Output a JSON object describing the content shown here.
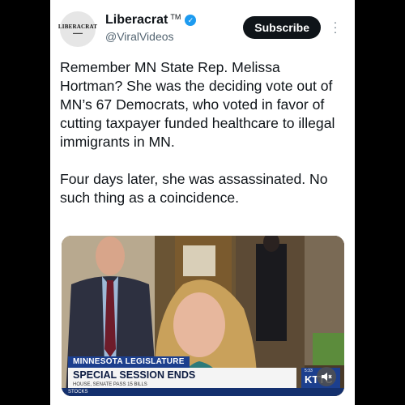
{
  "account": {
    "avatar_logo_text": "LIBERACRAT",
    "display_name": "Liberacrat",
    "trademark": "TM",
    "handle": "@ViralVideos",
    "verified_color": "#1d9bf0"
  },
  "actions": {
    "subscribe_label": "Subscribe",
    "more_icon": "more-vertical-icon"
  },
  "tweet": {
    "paragraph1": "Remember MN State Rep. Melissa Hortman? She was the deciding vote out of MN’s 67 Democrats, who voted in favor of cutting taxpayer funded healthcare to illegal immigrants in MN.",
    "paragraph2": "Four days later, she was assassinated. No such thing as a coincidence."
  },
  "video": {
    "chyron_top": "MINNESOTA LEGISLATURE",
    "chyron_main": "SPECIAL SESSION ENDS",
    "chyron_sub": "HOUSE, SENATE PASS 15 BILLS",
    "ticker_label": "STOCKS",
    "station_time": "5:33",
    "station_call": "KTTC",
    "volume_icon": "mute-icon"
  },
  "colors": {
    "subscribe_bg": "#0f1419",
    "chyron_blue": "#1c3f8e"
  }
}
